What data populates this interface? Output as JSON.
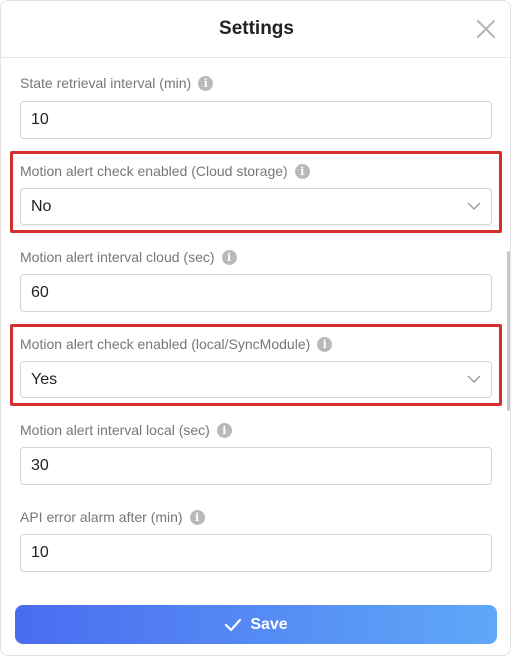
{
  "dialog": {
    "title": "Settings",
    "save_label": "Save"
  },
  "fields": {
    "state_interval": {
      "label": "State retrieval interval (min)",
      "value": "10"
    },
    "motion_cloud_enabled": {
      "label": "Motion alert check enabled (Cloud storage)",
      "value": "No"
    },
    "motion_cloud_interval": {
      "label": "Motion alert interval cloud (sec)",
      "value": "60"
    },
    "motion_local_enabled": {
      "label": "Motion alert check enabled (local/SyncModule)",
      "value": "Yes"
    },
    "motion_local_interval": {
      "label": "Motion alert interval local (sec)",
      "value": "30"
    },
    "api_error_alarm": {
      "label": "API error alarm after (min)",
      "value": "10"
    }
  },
  "icons": {
    "info": "info-icon",
    "close": "close-icon",
    "chevron": "chevron-down-icon",
    "check": "check-icon"
  },
  "colors": {
    "highlight": "#d32f2f",
    "button_start": "#4a6cf0",
    "button_end": "#5fa8f8"
  }
}
